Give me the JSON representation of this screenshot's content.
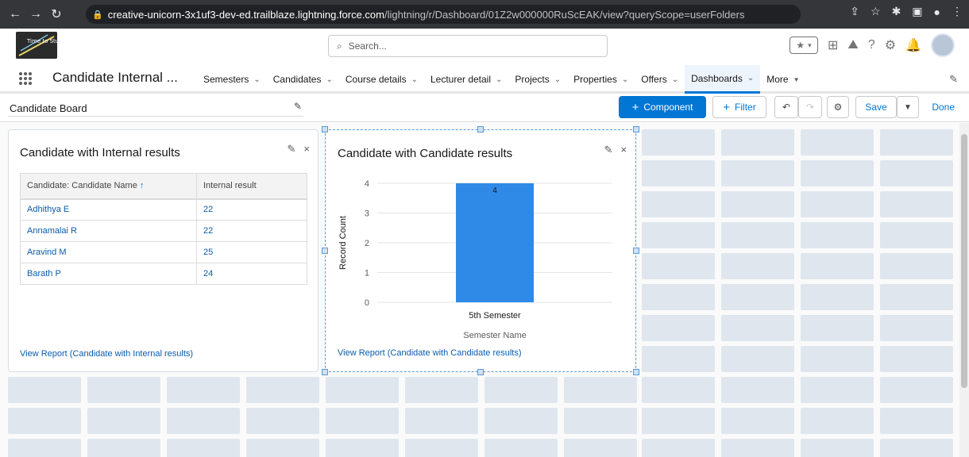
{
  "browser": {
    "url_domain": "creative-unicorn-3x1uf3-dev-ed.trailblaze.lightning.force.com",
    "url_path": "/lightning/r/Dashboard/01Z2w000000RuScEAK/view?queryScope=userFolders"
  },
  "header": {
    "search_placeholder": "Search...",
    "logo_text": "Time to Study!!"
  },
  "app": {
    "name": "Candidate Internal ...",
    "nav": [
      {
        "label": "Semesters",
        "id": "semesters"
      },
      {
        "label": "Candidates",
        "id": "candidates"
      },
      {
        "label": "Course details",
        "id": "course-details"
      },
      {
        "label": "Lecturer detail",
        "id": "lecturer-detail"
      },
      {
        "label": "Projects",
        "id": "projects"
      },
      {
        "label": "Properties",
        "id": "properties"
      },
      {
        "label": "Offers",
        "id": "offers"
      },
      {
        "label": "Dashboards",
        "id": "dashboards",
        "active": true
      },
      {
        "label": "More",
        "id": "more"
      }
    ]
  },
  "toolbar": {
    "board_name": "Candidate Board",
    "component_label": "Component",
    "filter_label": "Filter",
    "save_label": "Save",
    "done_label": "Done"
  },
  "widget1": {
    "title": "Candidate with Internal results",
    "columns": [
      "Candidate: Candidate Name",
      "Internal result"
    ],
    "rows": [
      [
        "Adhithya E",
        "22"
      ],
      [
        "Annamalai R",
        "22"
      ],
      [
        "Aravind M",
        "25"
      ],
      [
        "Barath P",
        "24"
      ]
    ],
    "view_report": "View Report (Candidate with Internal results)"
  },
  "widget2": {
    "title": "Candidate with Candidate results",
    "view_report": "View Report (Candidate with Candidate results)"
  },
  "chart_data": {
    "type": "bar",
    "categories": [
      "5th Semester"
    ],
    "values": [
      4
    ],
    "xlabel": "Semester Name",
    "ylabel": "Record Count",
    "ylim": [
      0,
      4
    ],
    "yticks": [
      0,
      1,
      2,
      3,
      4
    ],
    "bar_color": "#2e8ae6",
    "data_labels": true,
    "grid": true
  },
  "colors": {
    "brand": "#0176d3",
    "link": "#0b5cab",
    "grid_cell": "#dfe6ee"
  }
}
